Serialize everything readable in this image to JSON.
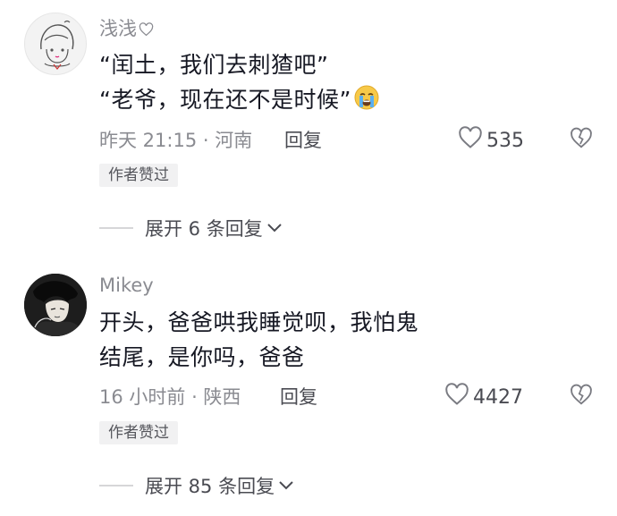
{
  "comments": [
    {
      "username": "浅浅",
      "lines": [
        "“闰土，我们去刺猹吧”",
        "“老爷，现在还不是时候”"
      ],
      "time_location": "昨天 21:15 · 河南",
      "reply_label": "回复",
      "like_count": "535",
      "author_badge": "作者赞过",
      "expand_label": "展开 6 条回复"
    },
    {
      "username": "Mikey",
      "lines": [
        "开头，爸爸哄我睡觉呗，我怕鬼",
        "结尾，是你吗，爸爸"
      ],
      "time_location": "16 小时前 · 陕西",
      "reply_label": "回复",
      "like_count": "4427",
      "author_badge": "作者赞过",
      "expand_label": "展开 85 条回复"
    }
  ],
  "icons": {
    "heart_small": "heart-outline-icon",
    "emoji": "loudly-crying-face-emoji",
    "like": "heart-outline-icon",
    "dislike": "broken-heart-icon",
    "chevron": "chevron-down-icon"
  },
  "colors": {
    "text_primary": "#161823",
    "text_secondary": "#8a8b91",
    "badge_bg": "#f1f1f2"
  }
}
